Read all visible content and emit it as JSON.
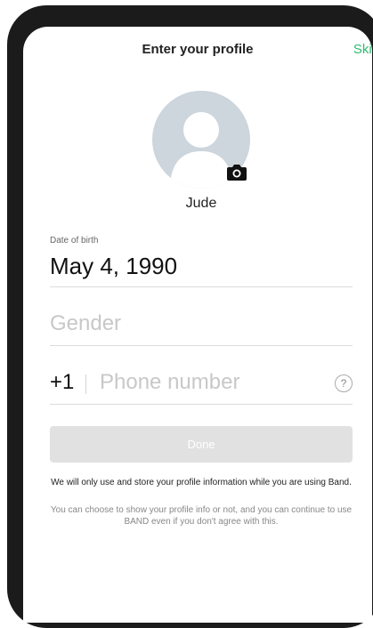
{
  "header": {
    "title": "Enter your profile",
    "skip_label": "Skip"
  },
  "profile": {
    "name": "Jude",
    "avatar_icon": "default-avatar-icon",
    "camera_icon": "camera-icon"
  },
  "dob": {
    "label": "Date of birth",
    "value": "May 4, 1990"
  },
  "gender": {
    "placeholder": "Gender"
  },
  "phone": {
    "country_code": "+1",
    "placeholder": "Phone number",
    "help_label": "?"
  },
  "done_button": {
    "label": "Done"
  },
  "notice": {
    "main": "We will only use and store your profile information while you are using Band.",
    "sub": "You can choose to show your profile info or not, and you can continue to use BAND even if you don't agree with this."
  },
  "colors": {
    "accent": "#2dbd6e",
    "disabled_button": "#e1e1e1",
    "avatar_bg": "#cdd5dd"
  }
}
